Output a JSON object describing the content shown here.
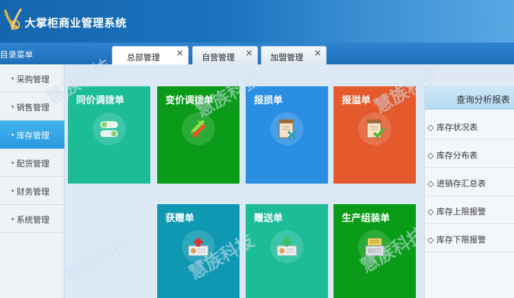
{
  "app": {
    "title": "大掌柜商业管理系统"
  },
  "menu_label": "目录菜单",
  "tabs": [
    {
      "label": "总部管理",
      "active": true
    },
    {
      "label": "自营管理",
      "active": false
    },
    {
      "label": "加盟管理",
      "active": false
    }
  ],
  "close_glyph": "✕",
  "sidebar": {
    "items": [
      {
        "label": "采购管理",
        "active": false
      },
      {
        "label": "销售管理",
        "active": false
      },
      {
        "label": "库存管理",
        "active": true
      },
      {
        "label": "配货管理",
        "active": false
      },
      {
        "label": "财务管理",
        "active": false
      },
      {
        "label": "系统管理",
        "active": false
      }
    ]
  },
  "tiles": [
    {
      "label": "同价调拨单",
      "color": "#1dbc98",
      "icon": "toggle-icon"
    },
    {
      "label": "变价调拨单",
      "color": "#0a9c18",
      "icon": "arrows-icon"
    },
    {
      "label": "报损单",
      "color": "#2a8ee3",
      "icon": "damage-report-icon"
    },
    {
      "label": "报溢单",
      "color": "#e45a2d",
      "icon": "overflow-report-icon"
    },
    {
      "label": "获赠单",
      "color": "#0e98b2",
      "icon": "gift-received-icon"
    },
    {
      "label": "赠送单",
      "color": "#1dbc98",
      "icon": "gift-send-icon"
    },
    {
      "label": "生产组装单",
      "color": "#0a9c18",
      "icon": "assembly-icon"
    }
  ],
  "report": {
    "title": "查询分析报表",
    "items": [
      {
        "label": "◇ 库存状况表"
      },
      {
        "label": "◇ 库存分布表"
      },
      {
        "label": "◇ 进销存汇总表"
      },
      {
        "label": "◇ 库存上限报警"
      },
      {
        "label": "◇ 库存下限报警"
      }
    ]
  },
  "watermark": "慧族科技"
}
